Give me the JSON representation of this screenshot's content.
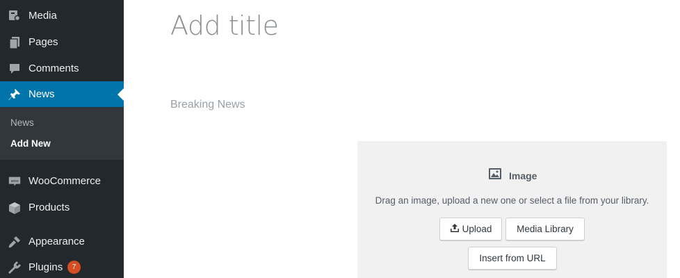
{
  "sidebar": {
    "items": [
      {
        "label": "Media",
        "icon": "media-icon"
      },
      {
        "label": "Pages",
        "icon": "pages-icon"
      },
      {
        "label": "Comments",
        "icon": "comments-icon"
      },
      {
        "label": "News",
        "icon": "pin-icon",
        "active": true
      },
      {
        "label": "WooCommerce",
        "icon": "woocommerce-icon"
      },
      {
        "label": "Products",
        "icon": "products-icon"
      },
      {
        "label": "Appearance",
        "icon": "appearance-icon"
      },
      {
        "label": "Plugins",
        "icon": "plugins-icon",
        "badge": "7"
      }
    ],
    "submenu": [
      {
        "label": "News"
      },
      {
        "label": "Add New",
        "current": true
      }
    ],
    "colors": {
      "background": "#23282d",
      "active": "#0073aa",
      "submenu": "#32373c",
      "badge": "#d54e21"
    }
  },
  "editor": {
    "title_placeholder": "Add title",
    "subtitle": "Breaking News"
  },
  "image_block": {
    "label": "Image",
    "instructions": "Drag an image, upload a new one or select a file from your library.",
    "upload_label": "Upload",
    "library_label": "Media Library",
    "url_label": "Insert from URL"
  }
}
